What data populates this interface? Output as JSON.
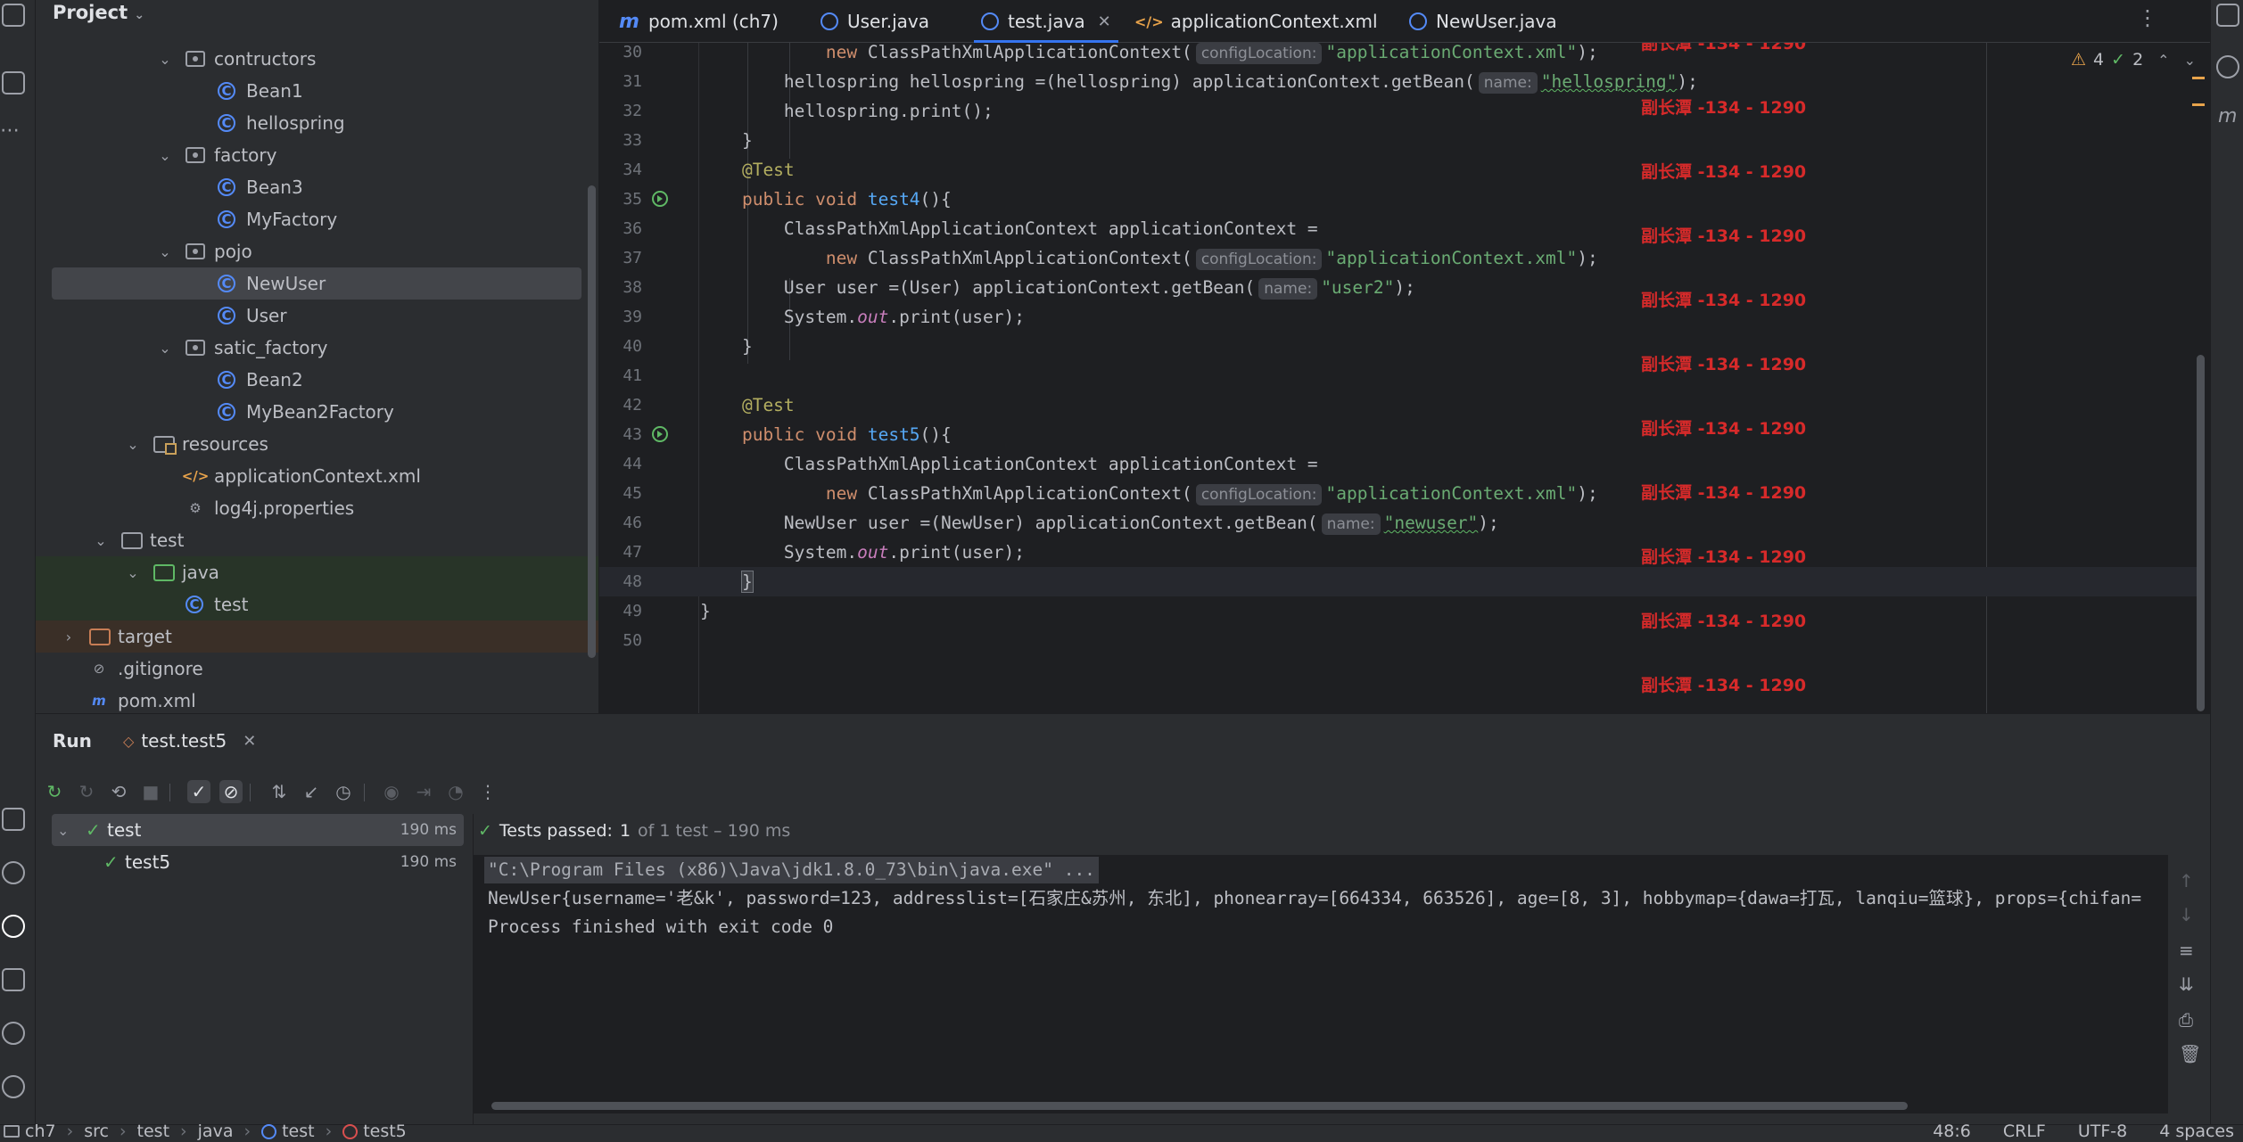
{
  "project": {
    "title": "Project",
    "tree": [
      {
        "label": "contructors",
        "icon": "package-icon",
        "indent": 3,
        "expanded": true
      },
      {
        "label": "Bean1",
        "icon": "class-icon",
        "indent": 4
      },
      {
        "label": "hellospring",
        "icon": "class-icon",
        "indent": 4
      },
      {
        "label": "factory",
        "icon": "package-icon",
        "indent": 3,
        "expanded": true
      },
      {
        "label": "Bean3",
        "icon": "class-icon",
        "indent": 4
      },
      {
        "label": "MyFactory",
        "icon": "class-icon",
        "indent": 4
      },
      {
        "label": "pojo",
        "icon": "package-icon",
        "indent": 3,
        "expanded": true
      },
      {
        "label": "NewUser",
        "icon": "class-icon",
        "indent": 4,
        "selected": true
      },
      {
        "label": "User",
        "icon": "class-icon",
        "indent": 4
      },
      {
        "label": "satic_factory",
        "icon": "package-icon",
        "indent": 3,
        "expanded": true
      },
      {
        "label": "Bean2",
        "icon": "class-icon",
        "indent": 4
      },
      {
        "label": "MyBean2Factory",
        "icon": "class-icon",
        "indent": 4
      },
      {
        "label": "resources",
        "icon": "resources-folder-icon",
        "indent": 2,
        "expanded": true
      },
      {
        "label": "applicationContext.xml",
        "icon": "xml-file-icon",
        "indent": 3
      },
      {
        "label": "log4j.properties",
        "icon": "properties-file-icon",
        "indent": 3
      },
      {
        "label": "test",
        "icon": "folder-icon",
        "indent": 1,
        "expanded": true
      },
      {
        "label": "java",
        "icon": "test-source-folder-icon",
        "indent": 2,
        "expanded": true
      },
      {
        "label": "test",
        "icon": "class-icon",
        "indent": 3
      },
      {
        "label": "target",
        "icon": "excluded-folder-icon",
        "indent": 0,
        "collapsed": true
      },
      {
        "label": ".gitignore",
        "icon": "gitignore-icon",
        "indent": 0
      },
      {
        "label": "pom.xml",
        "icon": "maven-icon",
        "indent": 0
      }
    ]
  },
  "tabs": [
    {
      "label": "pom.xml (ch7)",
      "icon": "maven-icon"
    },
    {
      "label": "User.java",
      "icon": "class-icon"
    },
    {
      "label": "test.java",
      "icon": "class-icon",
      "active": true
    },
    {
      "label": "applicationContext.xml",
      "icon": "xml-file-icon"
    },
    {
      "label": "NewUser.java",
      "icon": "class-icon"
    }
  ],
  "editor": {
    "inspections": {
      "warnings": "4",
      "weak_warnings": "2"
    },
    "lines": [
      {
        "n": "30",
        "parts": [
          [
            "",
            "            "
          ],
          [
            "kw",
            "new "
          ],
          [
            "",
            "ClassPathXmlApplicationContext("
          ],
          [
            "hint",
            "configLocation:"
          ],
          [
            "str",
            "\"applicationContext.xml\""
          ],
          [
            "",
            ");"
          ]
        ]
      },
      {
        "n": "31",
        "parts": [
          [
            "",
            "        hellospring hellospring =(hellospring) applicationContext.getBean("
          ],
          [
            "hint",
            "name:"
          ],
          [
            "strsq",
            "\"hellospring\""
          ],
          [
            "",
            ");"
          ]
        ]
      },
      {
        "n": "32",
        "parts": [
          [
            "",
            "        hellospring.print();"
          ]
        ]
      },
      {
        "n": "33",
        "parts": [
          [
            "",
            "    }"
          ]
        ]
      },
      {
        "n": "34",
        "parts": [
          [
            "ann",
            "    @Test"
          ]
        ]
      },
      {
        "n": "35",
        "run": true,
        "parts": [
          [
            "kw",
            "    public void "
          ],
          [
            "fn",
            "test4"
          ],
          [
            "",
            "(){"
          ]
        ]
      },
      {
        "n": "36",
        "parts": [
          [
            "",
            "        ClassPathXmlApplicationContext applicationContext ="
          ]
        ]
      },
      {
        "n": "37",
        "parts": [
          [
            "",
            "            "
          ],
          [
            "kw",
            "new "
          ],
          [
            "",
            "ClassPathXmlApplicationContext("
          ],
          [
            "hint",
            "configLocation:"
          ],
          [
            "str",
            "\"applicationContext.xml\""
          ],
          [
            "",
            ");"
          ]
        ]
      },
      {
        "n": "38",
        "parts": [
          [
            "",
            "        User user =(User) applicationContext.getBean("
          ],
          [
            "hint",
            "name:"
          ],
          [
            "str",
            "\"user2\""
          ],
          [
            "",
            ");"
          ]
        ]
      },
      {
        "n": "39",
        "parts": [
          [
            "",
            "        System."
          ],
          [
            "it",
            "out"
          ],
          [
            "",
            ".print(user);"
          ]
        ]
      },
      {
        "n": "40",
        "parts": [
          [
            "",
            "    }"
          ]
        ]
      },
      {
        "n": "41",
        "parts": [
          [
            "",
            ""
          ]
        ]
      },
      {
        "n": "42",
        "parts": [
          [
            "ann",
            "    @Test"
          ]
        ]
      },
      {
        "n": "43",
        "run": true,
        "parts": [
          [
            "kw",
            "    public void "
          ],
          [
            "fn",
            "test5"
          ],
          [
            "",
            "(){"
          ]
        ]
      },
      {
        "n": "44",
        "parts": [
          [
            "",
            "        ClassPathXmlApplicationContext applicationContext ="
          ]
        ]
      },
      {
        "n": "45",
        "parts": [
          [
            "",
            "            "
          ],
          [
            "kw",
            "new "
          ],
          [
            "",
            "ClassPathXmlApplicationContext("
          ],
          [
            "hint",
            "configLocation:"
          ],
          [
            "str",
            "\"applicationContext.xml\""
          ],
          [
            "",
            ");"
          ]
        ]
      },
      {
        "n": "46",
        "parts": [
          [
            "",
            "        NewUser user =(NewUser) applicationContext.getBean("
          ],
          [
            "hint",
            "name:"
          ],
          [
            "strsq",
            "\"newuser\""
          ],
          [
            "",
            ");"
          ]
        ]
      },
      {
        "n": "47",
        "parts": [
          [
            "",
            "        System."
          ],
          [
            "it",
            "out"
          ],
          [
            "",
            ".print(user);"
          ]
        ]
      },
      {
        "n": "48",
        "caret": true,
        "parts": [
          [
            "",
            "    "
          ],
          [
            "br",
            "}"
          ]
        ]
      },
      {
        "n": "49",
        "parts": [
          [
            "",
            "}"
          ]
        ]
      },
      {
        "n": "50",
        "parts": [
          [
            "",
            ""
          ]
        ]
      }
    ],
    "watermark": "副长潭 -134 - 1290"
  },
  "run": {
    "title": "Run",
    "tab_label": "test.test5",
    "tree": [
      {
        "label": "test",
        "duration": "190 ms",
        "level": 0
      },
      {
        "label": "test5",
        "duration": "190 ms",
        "level": 1
      }
    ],
    "status": {
      "passed_label": "Tests passed:",
      "passed_count": "1",
      "detail": "of 1 test – 190 ms"
    },
    "console": [
      "\"C:\\Program Files (x86)\\Java\\jdk1.8.0_73\\bin\\java.exe\" ...",
      "NewUser{username='老&k', password=123, addresslist=[石家庄&苏州, 东北], phonearray=[664334, 663526], age=[8, 3], hobbymap={dawa=打瓦, lanqiu=篮球}, props={chifan=",
      "Process finished with exit code 0"
    ]
  },
  "status_bar": {
    "breadcrumb": [
      "ch7",
      "src",
      "test",
      "java",
      "test",
      "test5"
    ],
    "position": "48:6",
    "line_sep": "CRLF",
    "encoding": "UTF-8",
    "indent": "4 spaces"
  },
  "colors": {
    "accent": "#3574f0",
    "success": "#5fb865",
    "watermark": "#d72a2a"
  }
}
